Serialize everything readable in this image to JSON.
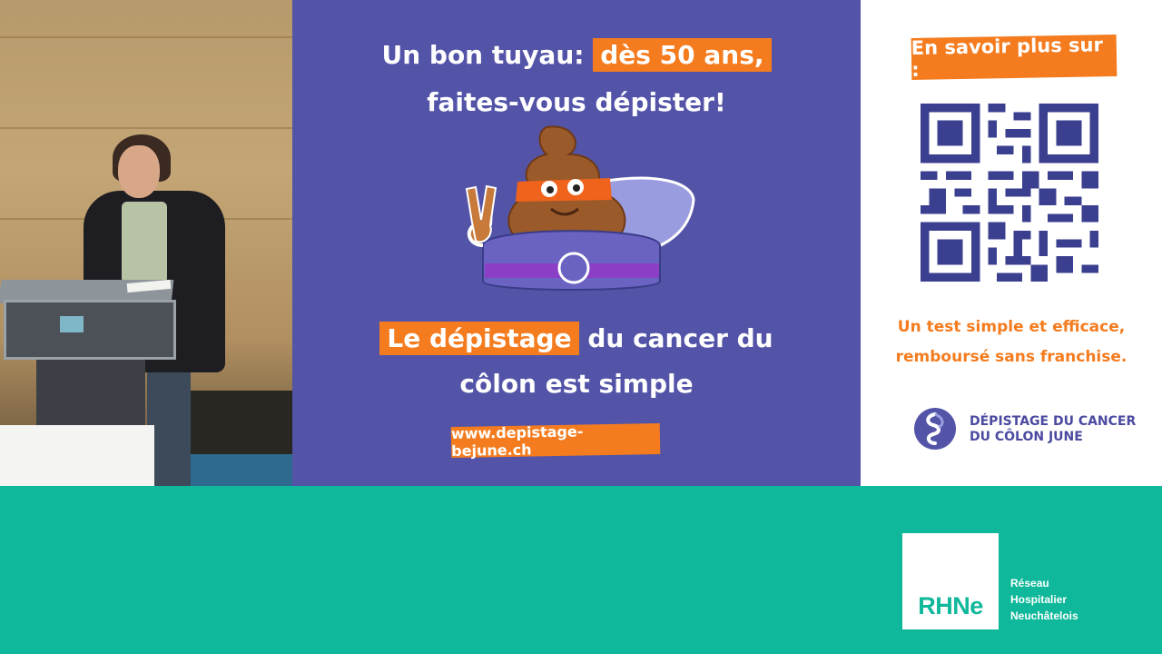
{
  "slide": {
    "line1_plain": "Un bon tuyau: ",
    "line1_highlight": "dès 50 ans,",
    "line2": "faites-vous dépister!",
    "line3_highlight": "Le dépistage",
    "line3_plain": " du cancer du",
    "line4": "côlon est simple",
    "url": "www.depistage-bejune.ch"
  },
  "info": {
    "title": "En savoir plus sur :",
    "tag1": "Un test simple et efficace,",
    "tag2": "remboursé sans franchise.",
    "logo_line1": "DÉPISTAGE DU CANCER",
    "logo_line2": "DU CÔLON JUNE"
  },
  "footer": {
    "logo_label": "RHNe",
    "org_line1": "Réseau",
    "org_line2": "Hospitalier",
    "org_line3": "Neuchâtelois"
  },
  "colors": {
    "purple": "#5354a8",
    "orange": "#f47c1f",
    "teal": "#0fb89a",
    "navy": "#3b3f8f"
  },
  "icons": {
    "mascot": "superhero-poop-mascot",
    "qr": "qr-code",
    "logo": "colon-logo-icon"
  }
}
